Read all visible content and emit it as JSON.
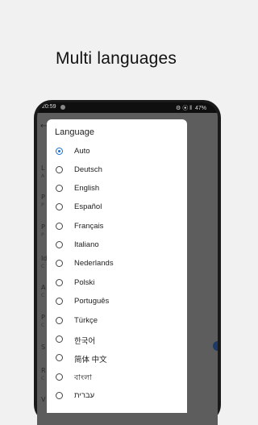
{
  "headline": "Multi languages",
  "status_bar": {
    "time": "20:59",
    "icons": "⚙ ⦿ ‖",
    "battery": "47%"
  },
  "background_list": {
    "letters": [
      "L",
      "P",
      "P",
      "Id",
      "A",
      "P",
      "S",
      "R",
      "V"
    ]
  },
  "dialog": {
    "title": "Language",
    "selected": "Auto",
    "options": [
      "Auto",
      "Deutsch",
      "English",
      "Español",
      "Français",
      "Italiano",
      "Nederlands",
      "Polski",
      "Português",
      "Türkçe",
      "한국어",
      "简体 中文",
      "বাংলা",
      "עברית"
    ]
  },
  "colors": {
    "accent": "#1a6fd1",
    "scrim": "#5d5d5d",
    "page_bg": "#f1f1f1"
  }
}
